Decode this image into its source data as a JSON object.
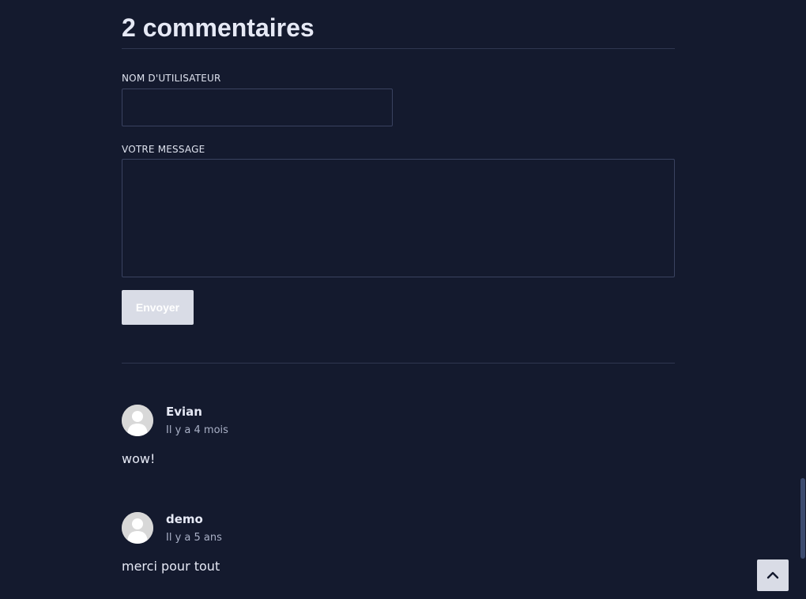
{
  "comments_section": {
    "title": "2 commentaires",
    "form": {
      "username_label": "NOM D'UTILISATEUR",
      "username_value": "",
      "message_label": "VOTRE MESSAGE",
      "message_value": "",
      "submit_label": "Envoyer"
    },
    "comments": [
      {
        "author": "Evian",
        "date": "Il y a 4 mois",
        "text": "wow!",
        "avatar_icon": "user-avatar-icon"
      },
      {
        "author": "demo",
        "date": "Il y a 5 ans",
        "text": "merci pour tout",
        "avatar_icon": "user-avatar-icon"
      }
    ]
  },
  "back_to_top": {
    "icon": "chevron-up-icon"
  },
  "colors": {
    "background": "#141a2e",
    "text": "#e6e9f5",
    "muted": "#a9b0c6",
    "button": "#d9dce6",
    "border": "#3a4260"
  }
}
